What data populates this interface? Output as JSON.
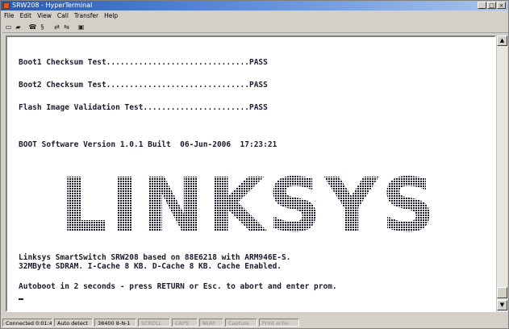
{
  "window": {
    "title": "SRW208 - HyperTerminal",
    "controls": {
      "minimize": "_",
      "maximize": "□",
      "close": "×"
    }
  },
  "menu": [
    "File",
    "Edit",
    "View",
    "Call",
    "Transfer",
    "Help"
  ],
  "toolbar": {
    "buttons": [
      {
        "name": "new-icon",
        "glyph": "▭"
      },
      {
        "name": "open-icon",
        "glyph": "▰"
      },
      {
        "name": "call-icon",
        "glyph": "☎"
      },
      {
        "name": "settings-icon",
        "glyph": "§"
      },
      {
        "name": "send-icon",
        "glyph": "⇄"
      },
      {
        "name": "receive-icon",
        "glyph": "⇆"
      },
      {
        "name": "properties-icon",
        "glyph": "▣"
      }
    ]
  },
  "terminal": {
    "lines": [
      "Boot1 Checksum Test...............................PASS",
      "Boot2 Checksum Test...............................PASS",
      "Flash Image Validation Test.......................PASS",
      "BOOT Software Version 1.0.1 Built  06-Jun-2006  17:23:21",
      "Linksys SmartSwitch SRW208 based on 88E6218 with ARM946E-S.",
      "32MByte SDRAM. I-Cache 8 KB. D-Cache 8 KB. Cache Enabled.",
      "Autoboot in 2 seconds - press RETURN or Esc. to abort and enter prom."
    ],
    "logo_text": "LINKSYS",
    "text_color": "#1a1a2e"
  },
  "statusbar": {
    "panels": [
      "Connected 0:01:49",
      "Auto detect",
      "38400 8-N-1",
      "SCROLL",
      "CAPS",
      "NUM",
      "Capture",
      "Print echo"
    ]
  }
}
